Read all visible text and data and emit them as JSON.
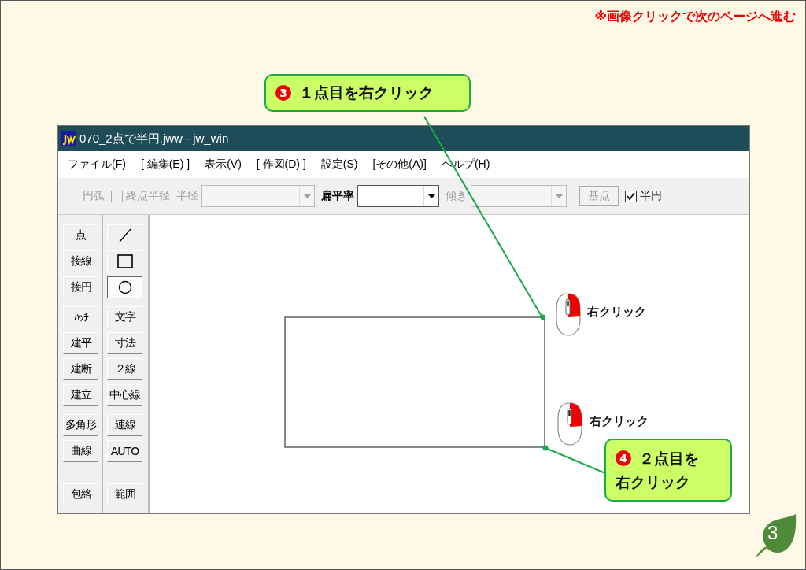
{
  "notice": "※画像クリックで次のページへ進む",
  "window": {
    "title": "070_2点で半円.jww - jw_win"
  },
  "menu": [
    {
      "label": "ファイル(F)"
    },
    {
      "label": "[ 編集(E) ]"
    },
    {
      "label": "表示(V)"
    },
    {
      "label": "[ 作図(D) ]"
    },
    {
      "label": "設定(S)"
    },
    {
      "label": "[その他(A)]"
    },
    {
      "label": "ヘルプ(H)"
    }
  ],
  "toolbar": [
    {
      "kind": "checkbox",
      "label": "円弧",
      "checked": false,
      "disabled": true
    },
    {
      "kind": "checkbox",
      "label": "終点半径",
      "checked": false,
      "disabled": true
    },
    {
      "kind": "combo",
      "label": "半径",
      "disabled": true
    },
    {
      "kind": "combo",
      "label": "扁平率",
      "disabled": false
    },
    {
      "kind": "combo",
      "label": "傾き",
      "disabled": true
    },
    {
      "kind": "button",
      "label": "基点",
      "disabled": true
    },
    {
      "kind": "checkbox",
      "label": "半円",
      "checked": true,
      "disabled": false
    }
  ],
  "palette": [
    {
      "groups": [
        {
          "rows": [
            [
              {
                "kind": "text",
                "label": "点",
                "selected": false
              },
              {
                "kind": "line",
                "selected": false
              }
            ],
            [
              {
                "kind": "text",
                "label": "接線",
                "selected": false
              },
              {
                "kind": "rect",
                "selected": false
              }
            ],
            [
              {
                "kind": "text",
                "label": "接円",
                "selected": false
              },
              {
                "kind": "circle",
                "selected": true
              }
            ]
          ]
        },
        {
          "rows": [
            [
              {
                "kind": "text",
                "label": "ﾊｯﾁ",
                "selected": false
              },
              {
                "kind": "text",
                "label": "文字",
                "selected": false
              }
            ],
            [
              {
                "kind": "text",
                "label": "建平",
                "selected": false
              },
              {
                "kind": "text",
                "label": "寸法",
                "selected": false
              }
            ],
            [
              {
                "kind": "text",
                "label": "建断",
                "selected": false
              },
              {
                "kind": "text",
                "label": "２線",
                "selected": false
              }
            ],
            [
              {
                "kind": "text",
                "label": "建立",
                "selected": false
              },
              {
                "kind": "text",
                "label": "中心線",
                "selected": false
              }
            ]
          ]
        },
        {
          "rows": [
            [
              {
                "kind": "text",
                "label": "多角形",
                "selected": false
              },
              {
                "kind": "text",
                "label": "連線",
                "selected": false
              }
            ],
            [
              {
                "kind": "text",
                "label": "曲線",
                "selected": false
              },
              {
                "kind": "text",
                "label": "AUTO",
                "selected": false
              }
            ]
          ]
        }
      ]
    },
    {
      "groups": [
        {
          "rows": [
            [
              {
                "kind": "text",
                "label": "包絡",
                "selected": false
              },
              {
                "kind": "text",
                "label": "範囲",
                "selected": false
              }
            ]
          ]
        }
      ]
    }
  ],
  "mouse_hints": [
    {
      "label": "右クリック"
    },
    {
      "label": "右クリック"
    }
  ],
  "callouts": [
    {
      "number": "3",
      "lines": [
        "１点目を右クリック"
      ]
    },
    {
      "number": "4",
      "lines": [
        "２点目を",
        "右クリック"
      ]
    }
  ],
  "page_number": "3"
}
